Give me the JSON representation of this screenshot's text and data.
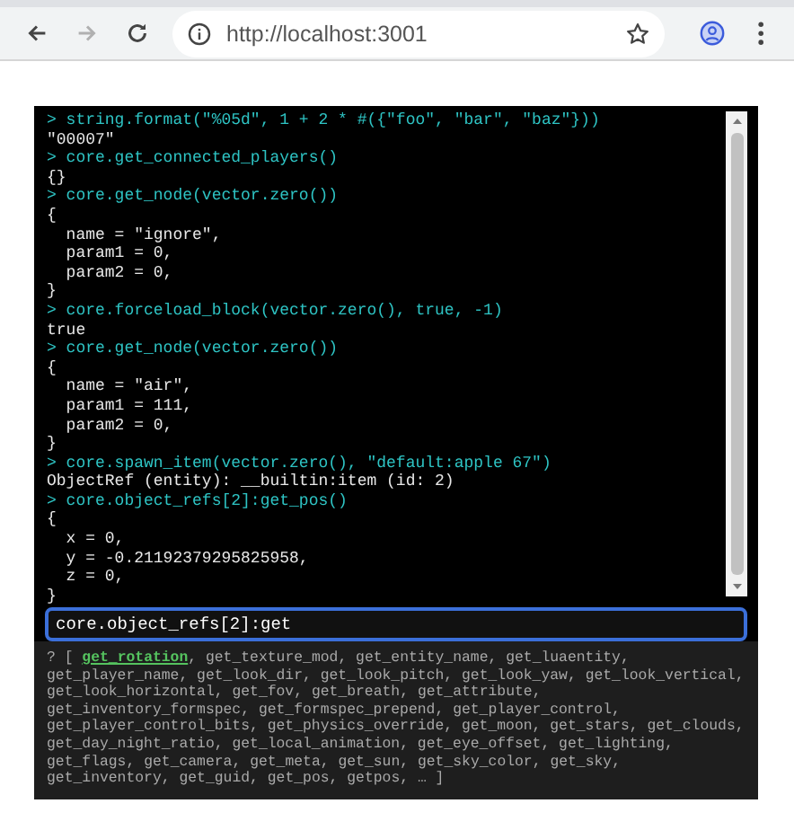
{
  "browser": {
    "nav": [
      {
        "kind": "back",
        "disabled": false
      },
      {
        "kind": "forward",
        "disabled": true
      },
      {
        "kind": "reload",
        "disabled": false
      }
    ],
    "url": "http://localhost:3001"
  },
  "console": {
    "lines": [
      {
        "kind": "input",
        "text": "> string.format(\"%05d\", 1 + 2 * #({\"foo\", \"bar\", \"baz\"}))"
      },
      {
        "kind": "output",
        "text": "\"00007\""
      },
      {
        "kind": "input",
        "text": "> core.get_connected_players()"
      },
      {
        "kind": "output",
        "text": "{}"
      },
      {
        "kind": "input",
        "text": "> core.get_node(vector.zero())"
      },
      {
        "kind": "output",
        "text": "{"
      },
      {
        "kind": "output",
        "text": "  name = \"ignore\","
      },
      {
        "kind": "output",
        "text": "  param1 = 0,"
      },
      {
        "kind": "output",
        "text": "  param2 = 0,"
      },
      {
        "kind": "output",
        "text": "}"
      },
      {
        "kind": "input",
        "text": "> core.forceload_block(vector.zero(), true, -1)"
      },
      {
        "kind": "output",
        "text": "true"
      },
      {
        "kind": "input",
        "text": "> core.get_node(vector.zero())"
      },
      {
        "kind": "output",
        "text": "{"
      },
      {
        "kind": "output",
        "text": "  name = \"air\","
      },
      {
        "kind": "output",
        "text": "  param1 = 111,"
      },
      {
        "kind": "output",
        "text": "  param2 = 0,"
      },
      {
        "kind": "output",
        "text": "}"
      },
      {
        "kind": "input",
        "text": "> core.spawn_item(vector.zero(), \"default:apple 67\")"
      },
      {
        "kind": "output",
        "text": "ObjectRef (entity): __builtin:item (id: 2)"
      },
      {
        "kind": "input",
        "text": "> core.object_refs[2]:get_pos()"
      },
      {
        "kind": "output",
        "text": "{"
      },
      {
        "kind": "output",
        "text": "  x = 0,"
      },
      {
        "kind": "output",
        "text": "  y = -0.21192379295825958,"
      },
      {
        "kind": "output",
        "text": "  z = 0,"
      },
      {
        "kind": "output",
        "text": "}"
      }
    ],
    "input": {
      "value": "core.object_refs[2]:get"
    },
    "completion": {
      "prefix": "? [",
      "separator": ",",
      "suffix": "… ]",
      "items": [
        {
          "text": "get_rotation",
          "selected": true
        },
        {
          "text": "get_texture_mod",
          "selected": false
        },
        {
          "text": "get_entity_name",
          "selected": false
        },
        {
          "text": "get_luaentity",
          "selected": false
        },
        {
          "text": "get_player_name",
          "selected": false
        },
        {
          "text": "get_look_dir",
          "selected": false
        },
        {
          "text": "get_look_pitch",
          "selected": false
        },
        {
          "text": "get_look_yaw",
          "selected": false
        },
        {
          "text": "get_look_vertical",
          "selected": false
        },
        {
          "text": "get_look_horizontal",
          "selected": false
        },
        {
          "text": "get_fov",
          "selected": false
        },
        {
          "text": "get_breath",
          "selected": false
        },
        {
          "text": "get_attribute",
          "selected": false
        },
        {
          "text": "get_inventory_formspec",
          "selected": false
        },
        {
          "text": "get_formspec_prepend",
          "selected": false
        },
        {
          "text": "get_player_control",
          "selected": false
        },
        {
          "text": "get_player_control_bits",
          "selected": false
        },
        {
          "text": "get_physics_override",
          "selected": false
        },
        {
          "text": "get_moon",
          "selected": false
        },
        {
          "text": "get_stars",
          "selected": false
        },
        {
          "text": "get_clouds",
          "selected": false
        },
        {
          "text": "get_day_night_ratio",
          "selected": false
        },
        {
          "text": "get_local_animation",
          "selected": false
        },
        {
          "text": "get_eye_offset",
          "selected": false
        },
        {
          "text": "get_lighting",
          "selected": false
        },
        {
          "text": "get_flags",
          "selected": false
        },
        {
          "text": "get_camera",
          "selected": false
        },
        {
          "text": "get_meta",
          "selected": false
        },
        {
          "text": "get_sun",
          "selected": false
        },
        {
          "text": "get_sky_color",
          "selected": false
        },
        {
          "text": "get_sky",
          "selected": false
        },
        {
          "text": "get_inventory",
          "selected": false
        },
        {
          "text": "get_guid",
          "selected": false
        },
        {
          "text": "get_pos",
          "selected": false
        },
        {
          "text": "getpos",
          "selected": false
        }
      ]
    }
  }
}
